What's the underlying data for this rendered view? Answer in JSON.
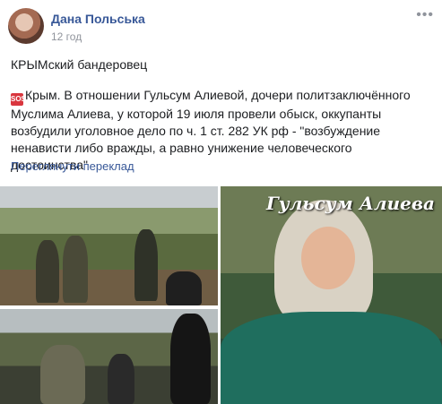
{
  "post": {
    "author": "Дана Польська",
    "time": "12 год",
    "more_glyph": "•••",
    "headline": "КРЫМский бандеровец",
    "sos_badge": "SOS",
    "body": "Крым. В отношении Гульсум Алиевой, дочери политзаключённого Муслима Алиева, у которой 19 июля провели обыск, оккупанты возбудили уголовное дело по ч. 1 ст. 282 УК рф - \"возбуждение ненависти либо вражды, а равно унижение человеческого достоинства\"",
    "translate_link": "Переглянути переклад"
  },
  "media": {
    "overlay_caption": "Гульсум Алиева"
  }
}
